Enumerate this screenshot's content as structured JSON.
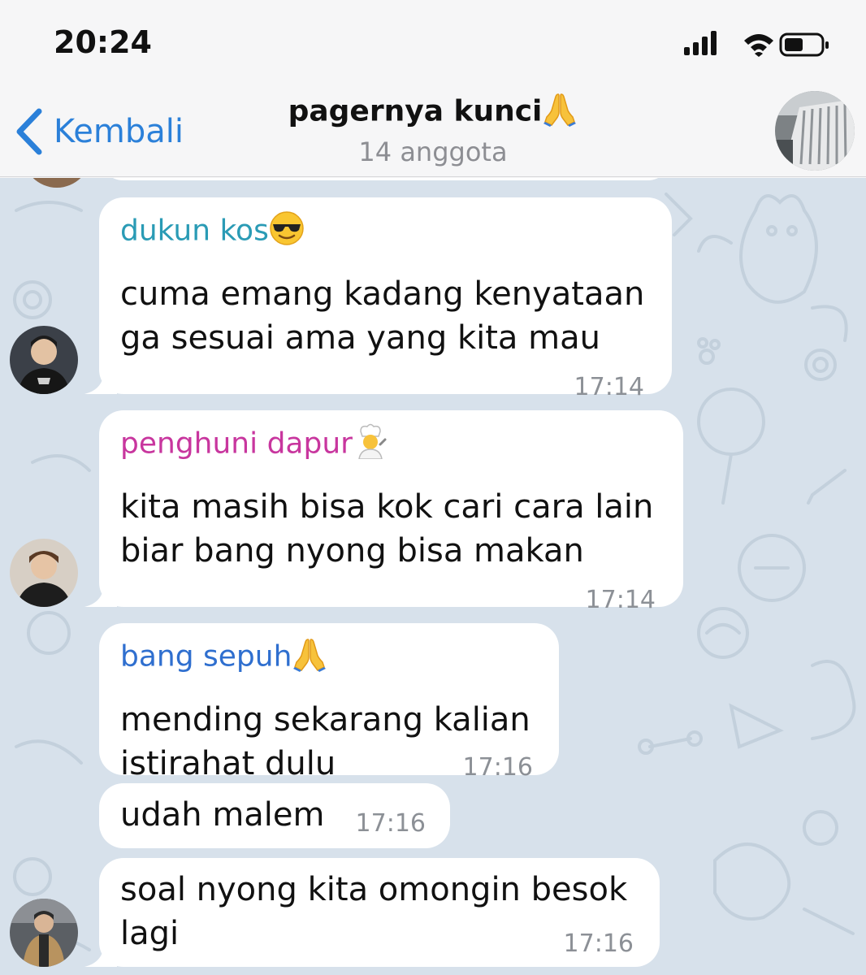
{
  "status_bar": {
    "time": "20:24"
  },
  "header": {
    "back_label": "Kembali",
    "title": "pagernya kunci",
    "title_emoji": "folded-hands",
    "subtitle": "14 anggota"
  },
  "colors": {
    "accent": "#2b80d9",
    "sender_dukun": "#2a9bb5",
    "sender_penghuni": "#c8369e",
    "sender_sepuh": "#2f6fcf",
    "chat_background": "#d7e1eb"
  },
  "messages": [
    {
      "sender": "dukun kos",
      "sender_emoji": "smiling-face-with-sunglasses",
      "text": "cuma emang kadang kenyataan\nga sesuai ama yang kita mau",
      "time": "17:14"
    },
    {
      "sender": "penghuni dapur",
      "sender_emoji": "cook",
      "text": "kita masih bisa kok cari cara lain\nbiar bang nyong bisa makan",
      "time": "17:14"
    },
    {
      "sender": "bang sepuh",
      "sender_emoji": "folded-hands",
      "text": "mending sekarang kalian\nistirahat dulu",
      "time": "17:16"
    },
    {
      "text": "udah malem",
      "time": "17:16"
    },
    {
      "text": "soal nyong kita omongin besok\nlagi",
      "time": "17:16"
    }
  ]
}
